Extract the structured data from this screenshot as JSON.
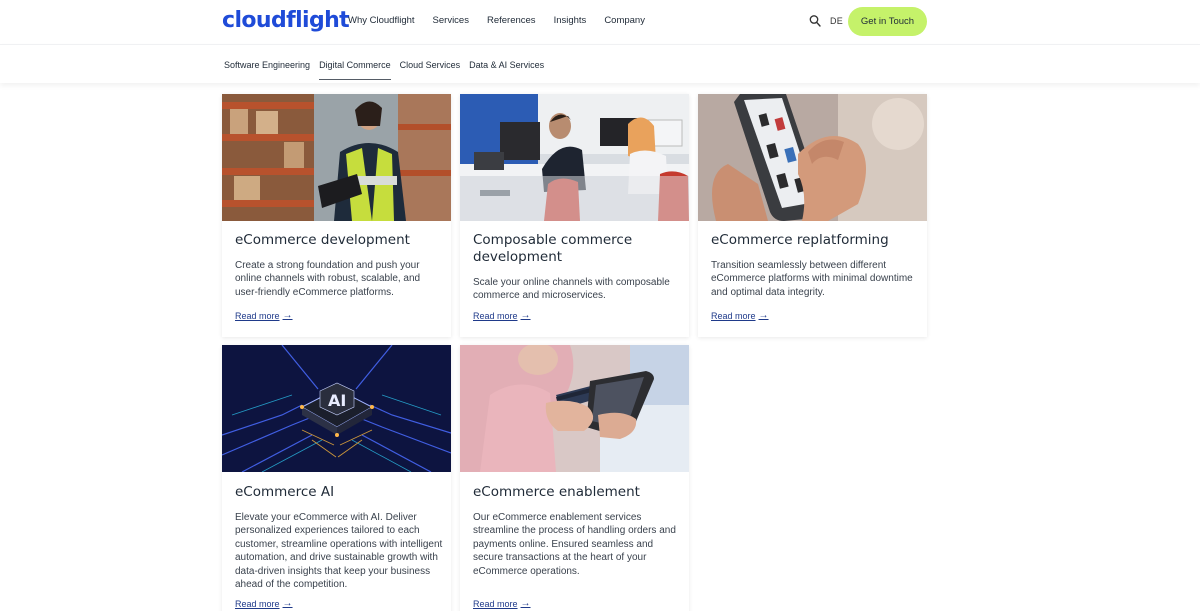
{
  "header": {
    "logo": "cloudflight",
    "nav": [
      "Why Cloudflight",
      "Services",
      "References",
      "Insights",
      "Company"
    ],
    "language": "DE",
    "cta_label": "Get in Touch",
    "accent_color": "#c5f26a",
    "brand_color": "#1f4bd8"
  },
  "subnav": {
    "items": [
      "Software Engineering",
      "Digital Commerce",
      "Cloud Services",
      "Data & AI Services"
    ],
    "active": "Digital Commerce"
  },
  "cards": [
    {
      "image": "warehouse-worker-tablet",
      "title": "eCommerce development",
      "description": "Create a strong foundation and push your online channels with robust, scalable, and user-friendly eCommerce platforms.",
      "link": "Read more"
    },
    {
      "image": "office-team-computers",
      "title": "Composable commerce development",
      "description": "Scale your online channels with composable commerce and microservices.",
      "link": "Read more"
    },
    {
      "image": "smartphone-shopping-app",
      "title": "eCommerce replatforming",
      "description": "Transition seamlessly between different eCommerce platforms with minimal downtime and optimal data integrity.",
      "link": "Read more"
    },
    {
      "image": "ai-chip-circuit",
      "title": "eCommerce AI",
      "description": "Elevate your eCommerce with AI. Deliver personalized experiences tailored to each customer, streamline operations with intelligent automation, and drive sustainable growth with data-driven insights that keep your business ahead of the competition.",
      "link": "Read more"
    },
    {
      "image": "card-phone-payment",
      "title": "eCommerce enablement",
      "description": "Our eCommerce enablement services streamline the process of handling orders and payments online. Ensured seamless and secure transactions at the heart of your eCommerce operations.",
      "link": "Read more"
    }
  ]
}
